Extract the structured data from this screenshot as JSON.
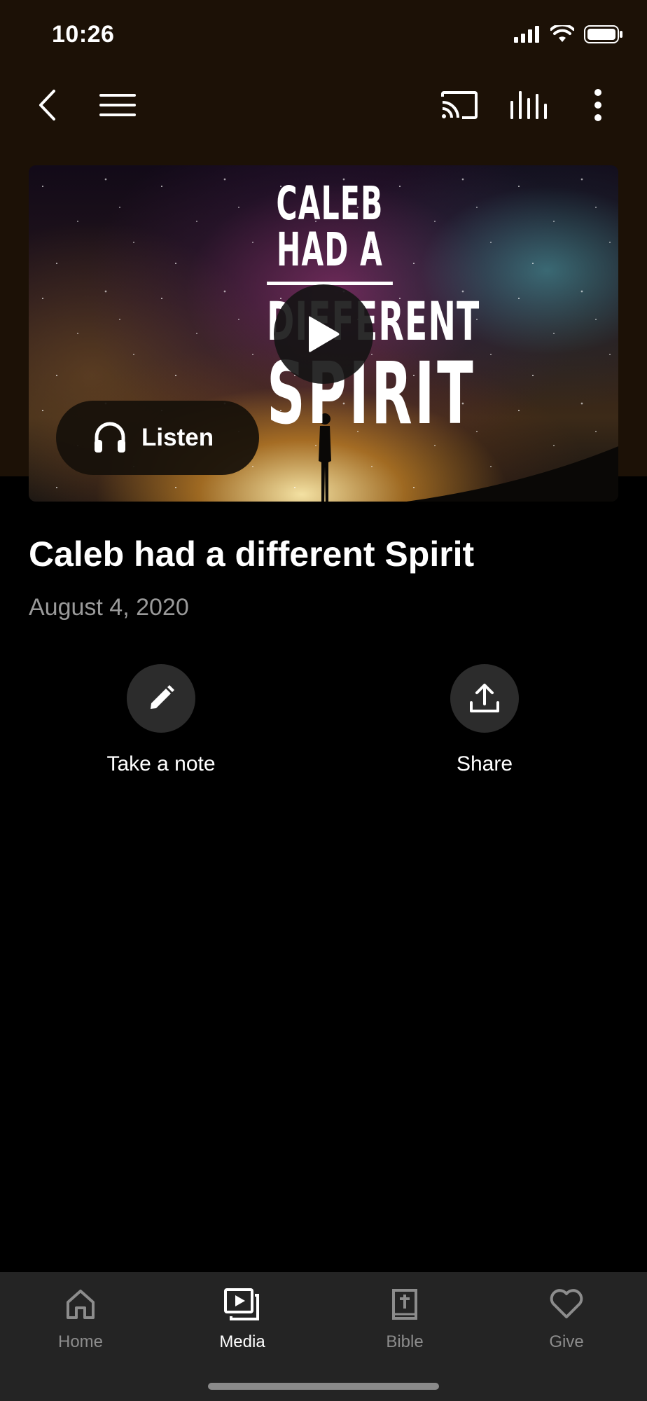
{
  "status_bar": {
    "time": "10:26"
  },
  "toolbar": {
    "back_icon": "chevron-left-icon",
    "menu_icon": "hamburger-menu-icon",
    "cast_icon": "cast-icon",
    "audio_icon": "audio-levels-icon",
    "more_icon": "more-vertical-icon"
  },
  "hero": {
    "artwork_title_line1": "CALEB HAD A",
    "artwork_title_line2": "DIFFERENT",
    "artwork_title_line3": "SPIRIT",
    "play_icon": "play-icon",
    "listen_label": "Listen",
    "listen_icon": "headphones-icon"
  },
  "episode": {
    "title": "Caleb had a different Spirit",
    "date": "August 4, 2020"
  },
  "actions": [
    {
      "label": "Take a note",
      "icon": "pencil-icon"
    },
    {
      "label": "Share",
      "icon": "share-icon"
    }
  ],
  "tabbar": {
    "active": "Media",
    "items": [
      {
        "label": "Home",
        "icon": "home-icon"
      },
      {
        "label": "Media",
        "icon": "media-icon"
      },
      {
        "label": "Bible",
        "icon": "bible-icon"
      },
      {
        "label": "Give",
        "icon": "heart-icon"
      }
    ]
  },
  "colors": {
    "header_bg": "#1c1106",
    "page_bg": "#000000",
    "tabbar_bg": "#242424",
    "inactive_tab": "#8c8c8c",
    "date_text": "#9a9a9a"
  }
}
